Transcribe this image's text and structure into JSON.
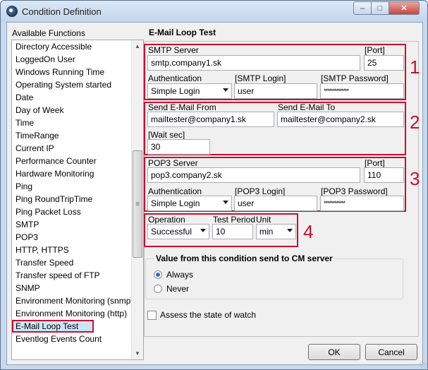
{
  "window": {
    "title": "Condition Definition",
    "buttons": {
      "minimize": "–",
      "maximize": "□",
      "close": "✕"
    }
  },
  "sidebar": {
    "label": "Available Functions",
    "selected_index": 22,
    "items": [
      "Directory Accessible",
      "LoggedOn User",
      "Windows Running Time",
      "Operating System started",
      "Date",
      "Day of Week",
      "Time",
      "TimeRange",
      "Current IP",
      "Performance Counter",
      "Hardware Monitoring",
      "Ping",
      "Ping RoundTripTime",
      "Ping Packet Loss",
      "SMTP",
      "POP3",
      "HTTP, HTTPS",
      "Transfer Speed",
      "Transfer speed of FTP",
      "SNMP",
      "Environment Monitoring (snmp)",
      "Environment Monitoring (http)",
      "E-Mail Loop Test",
      "Eventlog Events Count"
    ]
  },
  "panel": {
    "title": "E-Mail Loop Test",
    "smtp": {
      "server_label": "SMTP Server",
      "server_value": "smtp.company1.sk",
      "port_label": "[Port]",
      "port_value": "25",
      "auth_label": "Authentication",
      "auth_value": "Simple Login",
      "login_label": "[SMTP Login]",
      "login_value": "user",
      "password_label": "[SMTP Password]",
      "password_value": "**************"
    },
    "mail": {
      "from_label": "Send E-Mail From",
      "from_value": "mailtester@company1.sk",
      "to_label": "Send E-Mail To",
      "to_value": "mailtester@company2.sk",
      "wait_label": "[Wait sec]",
      "wait_value": "30"
    },
    "pop3": {
      "server_label": "POP3 Server",
      "server_value": "pop3.company2.sk",
      "port_label": "[Port]",
      "port_value": "110",
      "auth_label": "Authentication",
      "auth_value": "Simple Login",
      "login_label": "[POP3 Login]",
      "login_value": "user",
      "password_label": "[POP3 Password]",
      "password_value": "************"
    },
    "operation": {
      "operation_label": "Operation",
      "operation_value": "Successful",
      "period_label": "Test Period",
      "period_value": "10",
      "unit_label": "Unit",
      "unit_value": "min"
    },
    "callouts": [
      "1",
      "2",
      "3",
      "4"
    ],
    "send_group": {
      "title": "Value from this condition send to CM server",
      "options": [
        "Always",
        "Never"
      ],
      "selected": "Always"
    },
    "assess_label": "Assess the state of watch"
  },
  "footer": {
    "ok_label": "OK",
    "cancel_label": "Cancel"
  },
  "colors": {
    "highlight": "#c8102e",
    "selection": "#cde4f7",
    "radio": "#2d6fc4"
  }
}
